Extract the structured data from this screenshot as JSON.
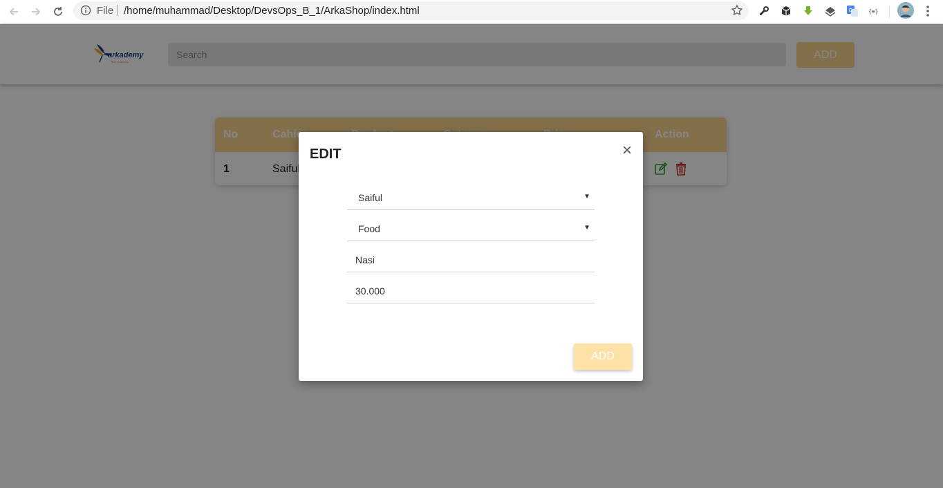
{
  "browser": {
    "file_label": "File",
    "url": "/home/muhammad/Desktop/DevsOps_B_1/ArkaShop/index.html"
  },
  "header": {
    "logo_text": "arkademy",
    "logo_tagline": "Tech Academy",
    "search_placeholder": "Search",
    "add_label": "ADD"
  },
  "table": {
    "columns": [
      "No",
      "Cahier",
      "Product",
      "Category",
      "Price",
      "Action"
    ],
    "rows": [
      {
        "no": "1",
        "cashier": "Saiful"
      }
    ]
  },
  "modal": {
    "title": "EDIT",
    "close_symbol": "×",
    "cashier_value": "Saiful",
    "category_value": "Food",
    "product_value": "Nasi",
    "price_value": "30.000",
    "add_label": "ADD"
  },
  "colors": {
    "accent": "#fbd58e",
    "edit_icon": "#2e9e3a",
    "delete_icon": "#d0312d"
  }
}
